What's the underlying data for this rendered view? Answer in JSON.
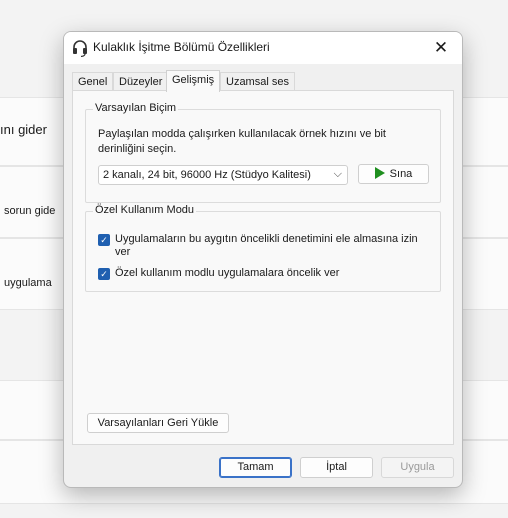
{
  "background": {
    "row1_text": "ını gider",
    "row2_text": "sorun gide",
    "row3_text": "uygulama"
  },
  "dialog": {
    "title": "Kulaklık İşitme Bölümü Özellikleri",
    "close_glyph": "✕",
    "tabs": [
      {
        "label": "Genel"
      },
      {
        "label": "Düzeyler"
      },
      {
        "label": "Gelişmiş"
      },
      {
        "label": "Uzamsal ses"
      }
    ],
    "active_tab": "Gelişmiş",
    "default_format": {
      "legend": "Varsayılan Biçim",
      "description": "Paylaşılan modda çalışırken kullanılacak örnek hızını ve bit derinliğini seçin.",
      "selected_format": "2 kanalı, 24 bit, 96000 Hz (Stüdyo Kalitesi)",
      "test_button": "Sına",
      "test_icon": "play-icon"
    },
    "exclusive_mode": {
      "legend": "Özel Kullanım Modu",
      "options": [
        {
          "label": "Uygulamaların bu aygıtın öncelikli denetimini ele almasına izin ver",
          "checked": true
        },
        {
          "label": "Özel kullanım modlu uygulamalara öncelik ver",
          "checked": true
        }
      ]
    },
    "restore_defaults_button": "Varsayılanları Geri Yükle",
    "buttons": {
      "ok": "Tamam",
      "cancel": "İptal",
      "apply": "Uygula"
    }
  },
  "colors": {
    "accent": "#1f5fb0",
    "play_green": "#1f8f1f"
  }
}
